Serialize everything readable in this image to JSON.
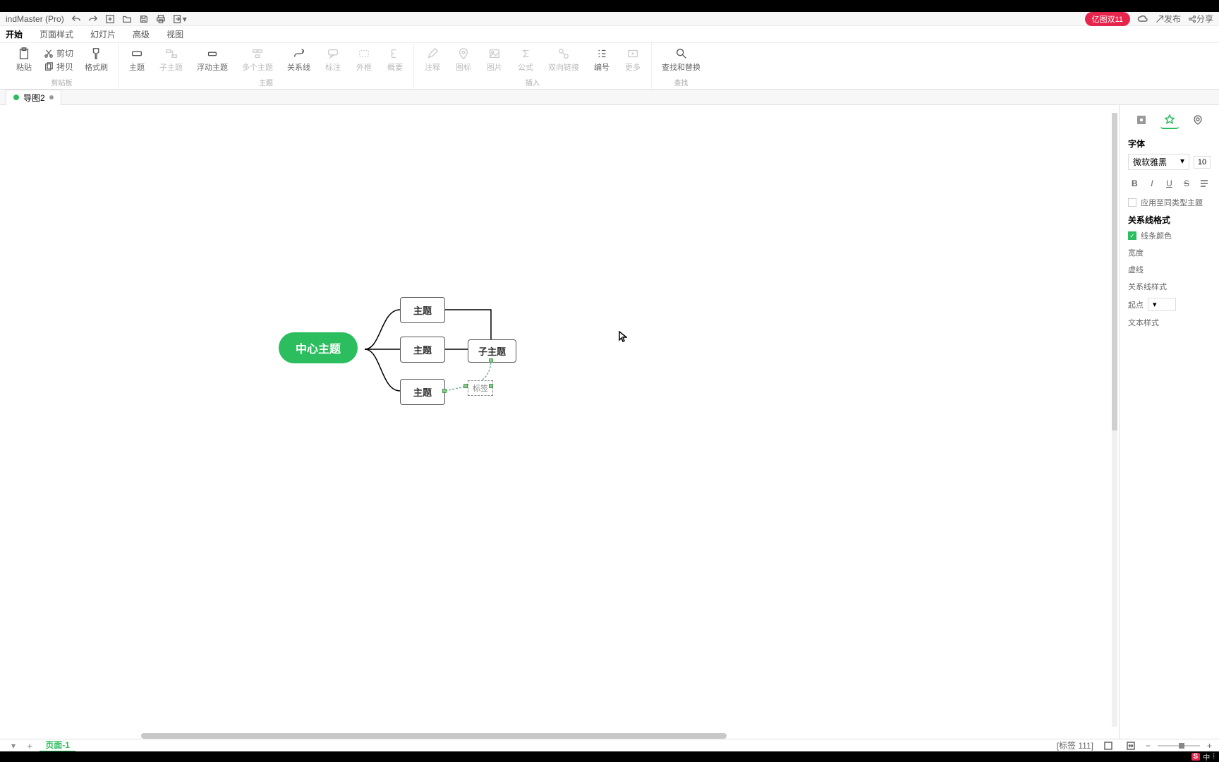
{
  "titlebar": {
    "app": "indMaster (Pro)"
  },
  "qat": {
    "promo": "亿图双11",
    "publish": "发布",
    "share": "分享"
  },
  "menu": {
    "items": [
      "开始",
      "页面样式",
      "幻灯片",
      "高级",
      "视图"
    ],
    "active": 0
  },
  "ribbon": {
    "clipboard": {
      "paste": "粘贴",
      "cut": "剪切",
      "copy": "拷贝",
      "format": "格式刷",
      "group": "剪贴板"
    },
    "topic": {
      "topic": "主题",
      "sub": "子主题",
      "float": "浮动主题",
      "multi": "多个主题",
      "rel": "关系线",
      "callout": "标注",
      "boundary": "外框",
      "summary": "概要",
      "group": "主题"
    },
    "insert": {
      "note": "注释",
      "marker": "图标",
      "image": "图片",
      "formula": "公式",
      "link": "双向链接",
      "number": "编号",
      "more": "更多",
      "group": "插入"
    },
    "find": {
      "find": "查找和替换",
      "group": "查找"
    }
  },
  "doctab": {
    "name": "导图2"
  },
  "mindmap": {
    "center": "中心主题",
    "topic1": "主题",
    "topic2": "主题",
    "topic3": "主题",
    "subtopic": "子主题",
    "label": "标签"
  },
  "rightpanel": {
    "font_section": "字体",
    "font_name": "微软雅黑",
    "font_size": "10",
    "apply_same": "应用至同类型主题",
    "rel_section": "关系线格式",
    "line_color": "线条颜色",
    "width": "宽度",
    "dash": "虚线",
    "rel_style": "关系线样式",
    "start": "起点",
    "text_style": "文本样式"
  },
  "statusbar": {
    "page": "页面-1",
    "info": "[标签 111]"
  },
  "ime": {
    "badge": "S",
    "lang": "中"
  }
}
